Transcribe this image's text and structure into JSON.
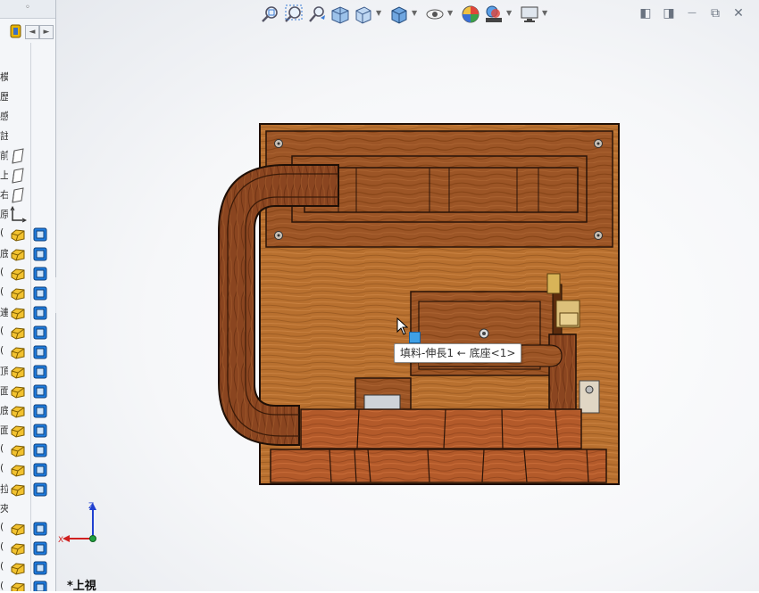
{
  "panel": {
    "collapse_label": "◦",
    "nav_prev": "◄",
    "nav_next": "►",
    "rows": [
      {
        "text": "模",
        "icon": "",
        "icon2": ""
      },
      {
        "text": "歷",
        "icon": "",
        "icon2": ""
      },
      {
        "text": "感",
        "icon": "",
        "icon2": ""
      },
      {
        "text": "註",
        "icon": "",
        "icon2": ""
      },
      {
        "text": "前",
        "icon": "plane-icon",
        "icon2": ""
      },
      {
        "text": "上",
        "icon": "plane-icon",
        "icon2": ""
      },
      {
        "text": "右",
        "icon": "plane-icon",
        "icon2": ""
      },
      {
        "text": "原",
        "icon": "origin-icon",
        "icon2": ""
      },
      {
        "text": "(",
        "icon": "part-icon",
        "icon2": "cube-icon"
      },
      {
        "text": "底",
        "icon": "part-icon",
        "icon2": "cube-icon"
      },
      {
        "text": "(",
        "icon": "part-icon",
        "icon2": "cube-icon"
      },
      {
        "text": "(",
        "icon": "part-icon",
        "icon2": "cube-icon"
      },
      {
        "text": "連",
        "icon": "part-icon",
        "icon2": "cube-icon"
      },
      {
        "text": "(",
        "icon": "part-icon",
        "icon2": "cube-icon"
      },
      {
        "text": "(",
        "icon": "part-icon",
        "icon2": "cube-icon"
      },
      {
        "text": "頂",
        "icon": "part-icon",
        "icon2": "cube-icon"
      },
      {
        "text": "面",
        "icon": "part-icon",
        "icon2": "cube-icon"
      },
      {
        "text": "底",
        "icon": "part-icon",
        "icon2": "cube-icon"
      },
      {
        "text": "面",
        "icon": "part-icon",
        "icon2": "cube-icon"
      },
      {
        "text": "(",
        "icon": "part-icon",
        "icon2": "cube-icon"
      },
      {
        "text": "(",
        "icon": "part-icon",
        "icon2": "cube-icon"
      },
      {
        "text": "拉",
        "icon": "part-icon",
        "icon2": "cube-icon"
      },
      {
        "text": "夾",
        "icon": "",
        "icon2": ""
      },
      {
        "text": "(",
        "icon": "part-icon",
        "icon2": "cube-icon"
      },
      {
        "text": "(",
        "icon": "part-icon",
        "icon2": "cube-icon"
      },
      {
        "text": "(",
        "icon": "part-icon",
        "icon2": "cube-icon"
      },
      {
        "text": "(",
        "icon": "part-icon",
        "icon2": "cube-icon"
      }
    ]
  },
  "toolbar": {
    "icons": [
      "zoom-to-fit-icon",
      "zoom-area-icon",
      "previous-view-icon",
      "section-view-icon",
      "view-orientation-icon",
      "display-style-icon",
      "hide-show-icon",
      "edit-appearance-icon",
      "apply-scene-icon",
      "view-settings-icon"
    ]
  },
  "window_controls": [
    "◧",
    "◨",
    "⧉",
    "✕"
  ],
  "tooltip": {
    "text": "填料-伸長1 ← 底座<1>"
  },
  "triad": {
    "x": "X",
    "y": "Y",
    "z": "Z"
  },
  "view": {
    "label": "*上視"
  },
  "colors": {
    "wood_light": "#b06a2c",
    "wood_dark": "#7a3b16",
    "wood_mid": "#9c5526",
    "outline": "#2a1408",
    "accent_blue": "#3fa0e6"
  }
}
